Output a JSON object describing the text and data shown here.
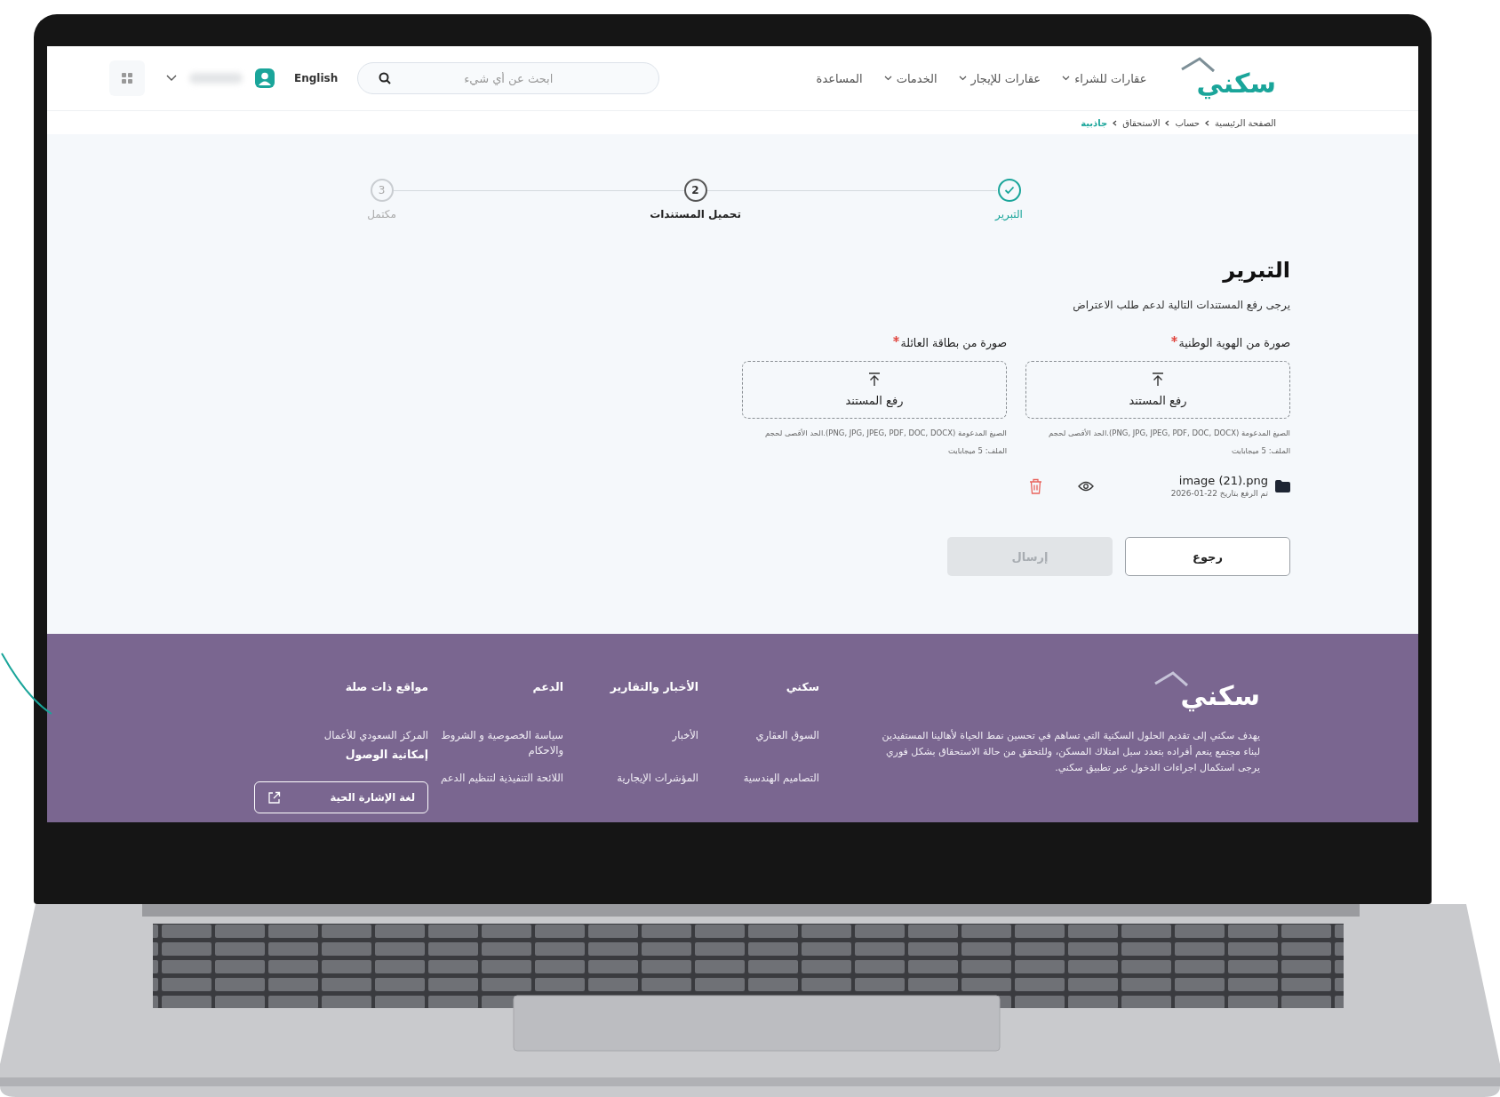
{
  "header": {
    "logo": "سكني",
    "nav": [
      {
        "label": "عقارات للشراء",
        "dropdown": true
      },
      {
        "label": "عقارات للإيجار",
        "dropdown": true
      },
      {
        "label": "الخدمات",
        "dropdown": true
      },
      {
        "label": "المساعدة",
        "dropdown": false
      }
    ],
    "search": {
      "placeholder": "ابحث عن أي شيء"
    },
    "language": "English"
  },
  "breadcrumb": [
    {
      "label": "الصفحة الرئيسية",
      "current": false
    },
    {
      "label": "حساب",
      "current": false
    },
    {
      "label": "الاستحقاق",
      "current": false
    },
    {
      "label": "جاذبية",
      "current": true
    }
  ],
  "steps": [
    {
      "label": "التبرير",
      "kind": "done"
    },
    {
      "number": "2",
      "label": "تحميل المستندات",
      "kind": "current"
    },
    {
      "number": "3",
      "label": "مكتمل",
      "kind": "pending"
    }
  ],
  "form": {
    "title": "التبرير",
    "subtitle": "يرجى رفع المستندات التالية لدعم طلب الاعتراض",
    "uploads": [
      {
        "label": "صورة من الهوية الوطنية",
        "required": true,
        "button": "رفع المستند",
        "hint": "الصيغ المدعومة (PNG, JPG, JPEG, PDF, DOC, DOCX).الحد الأقصى لحجم الملف: 5 ميجابايت",
        "file": {
          "name": "image (21).png",
          "uploaded": "تم الرفع بتاريخ 22-01-2026"
        }
      },
      {
        "label": "صورة من بطاقة العائلة",
        "required": true,
        "button": "رفع المستند",
        "hint": "الصيغ المدعومة (PNG, JPG, JPEG, PDF, DOC, DOCX).الحد الأقصى لحجم الملف: 5 ميجابايت"
      }
    ],
    "buttons": [
      {
        "label": "رجوع",
        "kind": "secondary",
        "disabled": false
      },
      {
        "label": "إرسال",
        "kind": "primary",
        "disabled": true
      }
    ]
  },
  "footer": {
    "logo": "سكني",
    "description": "يهدف سكني إلى تقديم الحلول السكنية التي تساهم في تحسين نمط الحياة لأهالينا المستفيدين لبناء مجتمع ينعم أفراده بتعدد سبل امتلاك المسكن، وللتحقق من حالة الاستحقاق بشكل فوري يرجى استكمال اجراءات الدخول عبر تطبيق سكني.",
    "columns": [
      {
        "title": "سكني",
        "links": [
          "السوق العقاري",
          "التصاميم الهندسية"
        ]
      },
      {
        "title": "الأخبار والتقارير",
        "links": [
          "الأخبار",
          "المؤشرات الإيجارية"
        ]
      },
      {
        "title": "الدعم",
        "links": [
          "سياسة الخصوصية و الشروط والاحكام",
          "اللائحة التنفيذية لتنظيم الدعم"
        ]
      },
      {
        "title": "مواقع ذات صلة",
        "links": [
          "المركز السعودي للأعمال"
        ]
      }
    ],
    "accessibility": {
      "title": "إمكانية الوصول",
      "button": "لغة الإشارة الحية"
    }
  }
}
